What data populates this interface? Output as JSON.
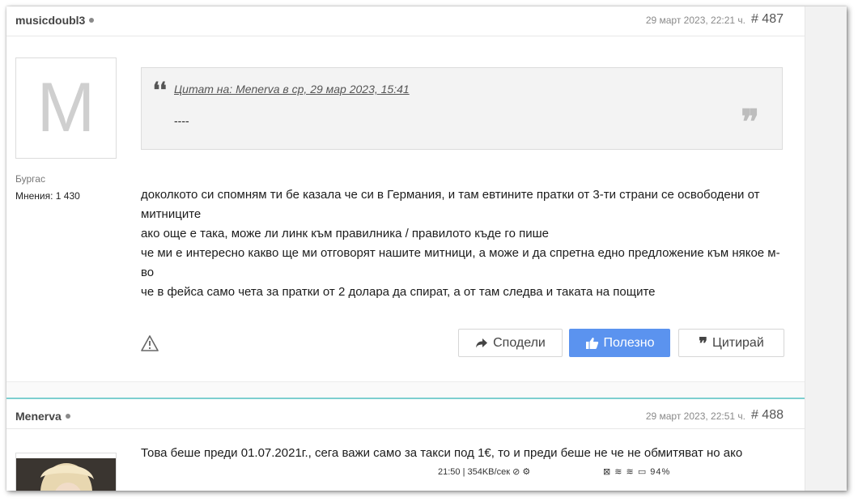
{
  "posts": [
    {
      "username": "musicdoubl3",
      "date": "29 март 2023, 22:21 ч.",
      "number": "# 487",
      "avatar_letter": "M",
      "location": "Бургас",
      "post_count": "Мнения: 1 430",
      "quote": {
        "link": "Цитат на: Menerva в ср, 29 мар 2023, 15:41",
        "text": "----"
      },
      "body": [
        "доколкото си спомням ти бе казала че си в Германия, и там евтините пратки от 3-ти страни се освободени от митниците",
        "ако още е така, може ли линк към правилника / правилото къде го пише",
        "че ми е интересно какво ще ми отговорят нашите митници, а може и да спретна едно предложение към някое м-во",
        "че в фейса само чета за пратки от 2 долара да спират, а от там следва и таката на пощите"
      ],
      "buttons": {
        "share": "Сподели",
        "useful": "Полезно",
        "quote": "Цитирай"
      }
    },
    {
      "username": "Menerva",
      "date": "29 март 2023, 22:51 ч.",
      "number": "# 488",
      "body": "Това беше преди 01.07.2021г., сега важи само за такси под 1€, то и преди беше не че не обмитяват но ако"
    }
  ],
  "statusbar": {
    "left": "21:50 | 354KB/сек",
    "battery": "94"
  },
  "colors": {
    "accent": "#5b93ef",
    "divider": "#7dcfd0"
  }
}
